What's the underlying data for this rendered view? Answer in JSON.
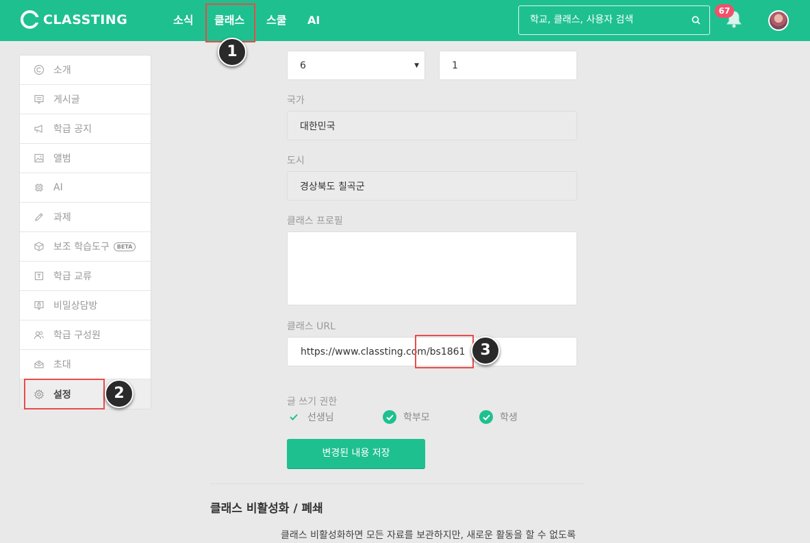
{
  "header": {
    "logo_text": "CLASSTING",
    "nav": [
      "소식",
      "클래스",
      "스쿨",
      "AI"
    ],
    "search_placeholder": "학교, 클래스, 사용자 검색",
    "notification_count": "67",
    "brand_color": "#1fc090"
  },
  "sidebar": {
    "items": [
      {
        "label": "소개",
        "icon": "copyright-icon"
      },
      {
        "label": "게시글",
        "icon": "post-icon"
      },
      {
        "label": "학급 공지",
        "icon": "megaphone-icon"
      },
      {
        "label": "앨범",
        "icon": "image-icon"
      },
      {
        "label": "AI",
        "icon": "chip-icon"
      },
      {
        "label": "과제",
        "icon": "pencil-icon"
      },
      {
        "label": "보조 학습도구",
        "icon": "cube-icon",
        "badge": "BETA"
      },
      {
        "label": "학급 교류",
        "icon": "exchange-icon"
      },
      {
        "label": "비밀상담방",
        "icon": "secret-chat-icon"
      },
      {
        "label": "학급 구성원",
        "icon": "members-icon"
      },
      {
        "label": "초대",
        "icon": "invite-icon"
      },
      {
        "label": "설정",
        "icon": "gear-icon"
      }
    ]
  },
  "form": {
    "grade_value": "6",
    "class_value": "1",
    "country_label": "국가",
    "country_value": "대한민국",
    "city_label": "도시",
    "city_value": "경상북도 칠곡군",
    "profile_label": "클래스 프로필",
    "profile_value": "",
    "url_label": "클래스 URL",
    "url_value": "https://www.classting.com/bs1861",
    "write_permission_label": "글 쓰기 권한",
    "permissions": [
      {
        "label": "선생님",
        "checked": true
      },
      {
        "label": "학부모",
        "checked": true
      },
      {
        "label": "학생",
        "checked": true
      }
    ],
    "save_label": "변경된 내용 저장"
  },
  "deactivate": {
    "title": "클래스 비활성화 / 폐쇄",
    "description": "클래스 비활성화하면 모든 자료를 보관하지만, 새로운 활동을 할 수 없도록"
  },
  "annotations": [
    "1",
    "2",
    "3"
  ]
}
